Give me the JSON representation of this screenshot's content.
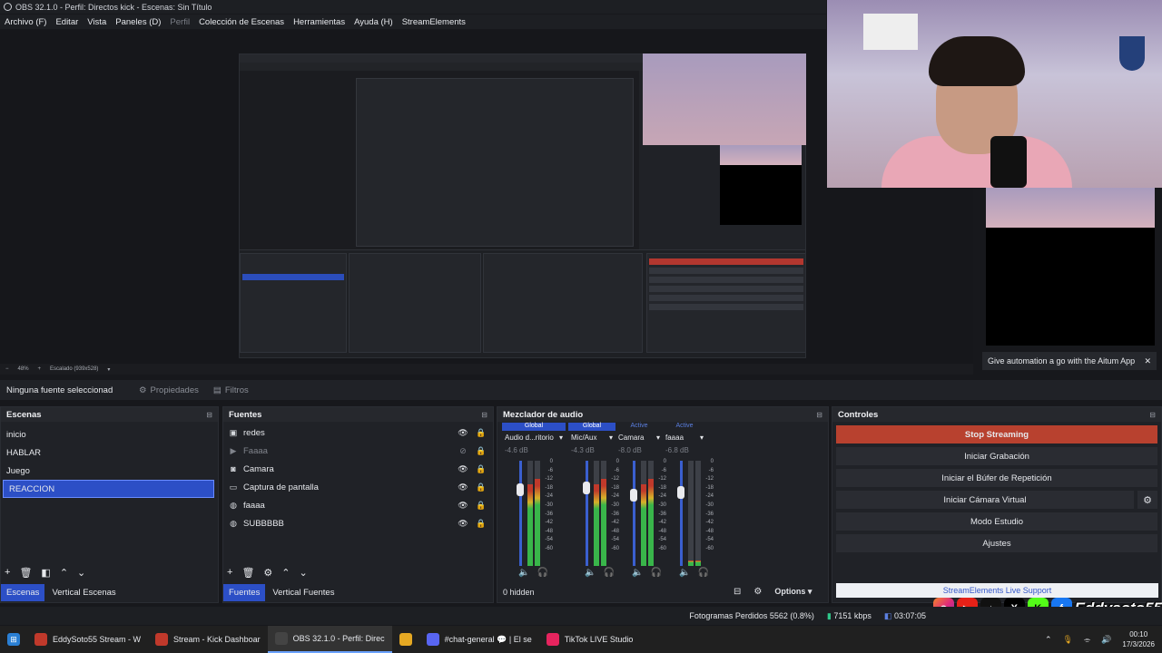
{
  "window": {
    "title": "OBS 32.1.0 - Perfil: Directos kick - Escenas: Sin Título"
  },
  "menu": [
    "Archivo (F)",
    "Editar",
    "Vista",
    "Paneles (D)",
    "Perfil",
    "Colección de Escenas",
    "Herramientas",
    "Ayuda (H)",
    "StreamElements"
  ],
  "preview": {
    "zoom": "48%",
    "scaling": "Escalado (939x528)"
  },
  "aitum": {
    "message": "Give automation a go with the Aitum App",
    "close": "✕"
  },
  "props_row": {
    "no_source": "Ninguna fuente seleccionad",
    "properties": "Propiedades",
    "filters": "Filtros"
  },
  "scenes": {
    "title": "Escenas",
    "items": [
      "inicio",
      "HABLAR",
      "Juego",
      "REACCION"
    ],
    "selected_index": 3,
    "tabs": [
      "Escenas",
      "Vertical Escenas"
    ]
  },
  "sources": {
    "title": "Fuentes",
    "items": [
      {
        "name": "redes",
        "icon": "image-icon"
      },
      {
        "name": "Faaaa",
        "icon": "play-icon",
        "hidden": true
      },
      {
        "name": "Camara",
        "icon": "camera-icon"
      },
      {
        "name": "Captura de pantalla",
        "icon": "monitor-icon"
      },
      {
        "name": "faaaa",
        "icon": "globe-icon"
      },
      {
        "name": "SUBBBBB",
        "icon": "globe-icon"
      }
    ],
    "tabs": [
      "Fuentes",
      "Vertical Fuentes"
    ]
  },
  "mixer": {
    "title": "Mezclador de audio",
    "channels": [
      {
        "scope": "Global",
        "name": "Audio d...ritorio",
        "db": "-4.6 dB",
        "level": 0.72
      },
      {
        "scope": "Global",
        "name": "Mic/Aux",
        "db": "-4.3 dB",
        "level": 0.74
      },
      {
        "scope": "Active",
        "name": "Camara",
        "db": "-8.0 dB",
        "level": 0.67
      },
      {
        "scope": "Active",
        "name": "faaaa",
        "db": "-6.8 dB",
        "level": 0.7
      }
    ],
    "scale": [
      "0",
      "-6",
      "-12",
      "-18",
      "-24",
      "-30",
      "-36",
      "-42",
      "-48",
      "-54",
      "-60"
    ],
    "hidden": "0 hidden",
    "options": "Options"
  },
  "controls": {
    "title": "Controles",
    "stop_streaming": "Stop Streaming",
    "start_recording": "Iniciar Grabación",
    "replay_buffer": "Iniciar el Búfer de Repetición",
    "virtual_cam": "Iniciar Cámara Virtual",
    "studio_mode": "Modo Estudio",
    "settings": "Ajustes",
    "se_support": "StreamElements Live Support"
  },
  "social": {
    "handle": "Eddysoto55"
  },
  "status": {
    "dropped": "Fotogramas Perdidos 5562 (0.8%)",
    "bitrate": "7151 kbps",
    "time": "03:07:05"
  },
  "taskbar": {
    "items": [
      {
        "label": "EddySoto55 Stream - W",
        "color": "#c0392b"
      },
      {
        "label": "Stream - Kick Dashboar",
        "color": "#c0392b"
      },
      {
        "label": "OBS 32.1.0 - Perfil: Direc",
        "color": "#444444"
      },
      {
        "label": "",
        "color": "#e5a823"
      },
      {
        "label": "#chat-general 💬 | El se",
        "color": "#5865f2"
      },
      {
        "label": "TikTok LIVE Studio",
        "color": "#e6245e"
      }
    ],
    "time": "00:10",
    "date": "17/3/2026"
  },
  "colors": {
    "accent": "#2c4fc6",
    "stop": "#b8412f"
  }
}
